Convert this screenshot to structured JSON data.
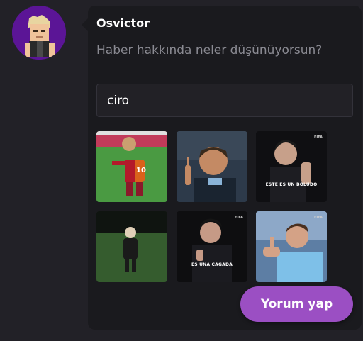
{
  "user": {
    "name": "Osvictor",
    "avatar_bg": "#5b1596"
  },
  "comment": {
    "placeholder": "Haber hakkında neler düşünüyorsun?"
  },
  "gif_search": {
    "value": "ciro"
  },
  "gifs": [
    {
      "caption": ""
    },
    {
      "caption": ""
    },
    {
      "caption": "ESTE ES UN BOLUDO",
      "watermark": "FIFA"
    },
    {
      "caption": ""
    },
    {
      "caption": "ES UNA CAGADA",
      "watermark": "FIFA"
    },
    {
      "caption": "",
      "watermark": "FIFA"
    }
  ],
  "submit": {
    "label": "Yorum yap"
  },
  "colors": {
    "accent": "#9b4fc3",
    "card": "#1a1a1e",
    "background": "#222127"
  }
}
